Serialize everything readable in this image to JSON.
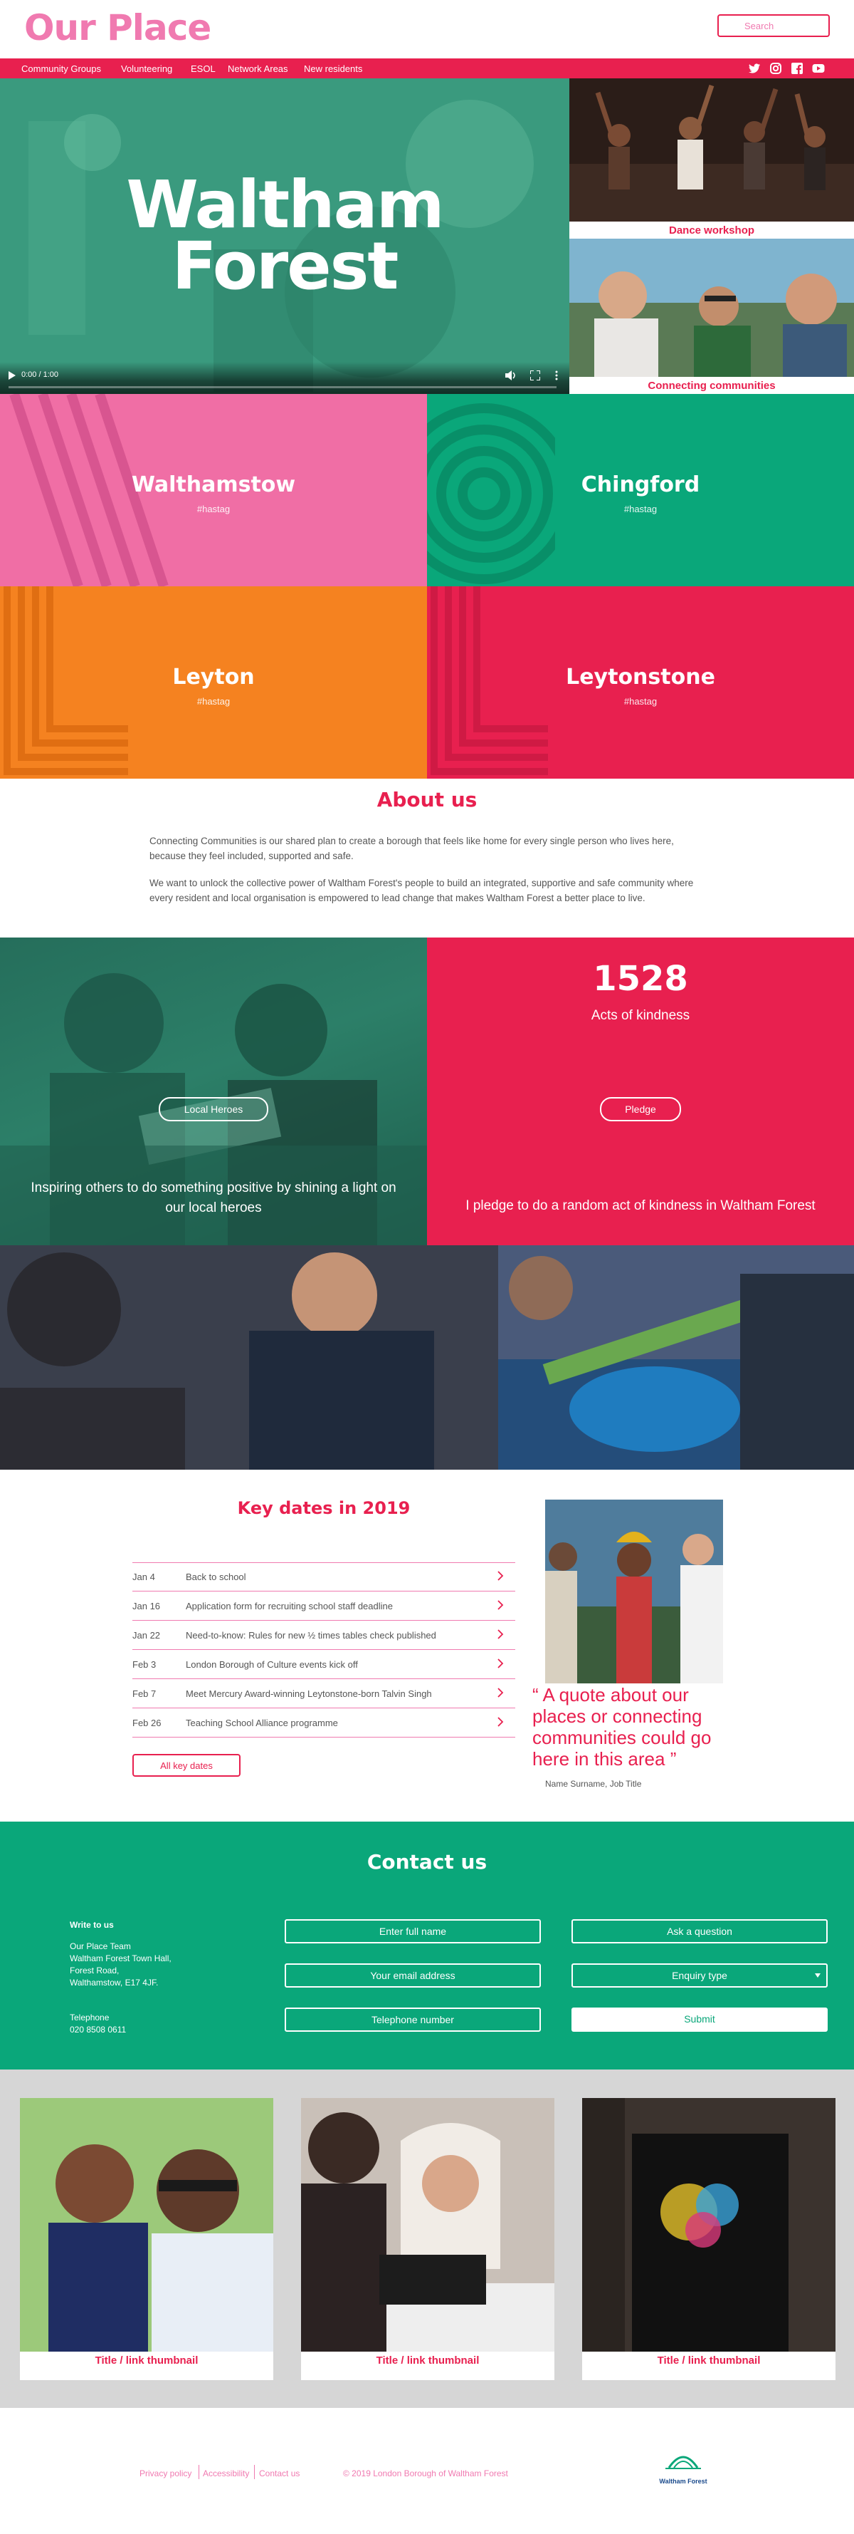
{
  "header": {
    "logo": "Our Place",
    "search_placeholder": "Search"
  },
  "nav": {
    "items": [
      "Community Groups",
      "Volunteering",
      "ESOL",
      "Network Areas",
      "New residents"
    ],
    "social": [
      "twitter-icon",
      "instagram-icon",
      "facebook-icon",
      "youtube-icon"
    ]
  },
  "hero": {
    "title_line1": "Waltham",
    "title_line2": "Forest",
    "video_time": "0:00 / 1:00",
    "video_progress": 0
  },
  "side_cards": [
    {
      "caption": "Dance workshop"
    },
    {
      "caption": "Connecting communities"
    }
  ],
  "areas": [
    {
      "name": "Walthamstow",
      "tag": "#hastag",
      "color": "#f06ea5"
    },
    {
      "name": "Chingford",
      "tag": "#hastag",
      "color": "#0aa77a"
    },
    {
      "name": "Leyton",
      "tag": "#hastag",
      "color": "#f58220"
    },
    {
      "name": "Leytonstone",
      "tag": "#hastag",
      "color": "#e8204f"
    }
  ],
  "about": {
    "title": "About us",
    "p1": "Connecting Communities is our shared plan to create a borough that feels like home for every single person who lives here, because they feel included, supported and safe.",
    "p2": "We want to unlock the collective power of Waltham Forest's people to build an integrated, supportive and safe community where every resident and local organisation is empowered to lead change that makes Waltham Forest a better place to live."
  },
  "heroes": {
    "button": "Local Heroes",
    "caption": "Inspiring others to do something positive by shining a light on our local heroes"
  },
  "pledge": {
    "count": "1528",
    "count_label": "Acts of kindness",
    "button": "Pledge",
    "caption": "I pledge to do a random act of kindness in Waltham Forest"
  },
  "key_dates": {
    "title": "Key dates in 2019",
    "rows": [
      {
        "date": "Jan 4",
        "text": "Back to school"
      },
      {
        "date": "Jan 16",
        "text": "Application form for recruiting school staff deadline"
      },
      {
        "date": "Jan 22",
        "text": "Need-to-know: Rules for new ½ times tables check published"
      },
      {
        "date": "Feb 3",
        "text": "London Borough of Culture events kick off"
      },
      {
        "date": "Feb 7",
        "text": "Meet Mercury Award-winning Leytonstone-born Talvin Singh"
      },
      {
        "date": "Feb 26",
        "text": "Teaching School Alliance programme"
      }
    ],
    "all_button": "All key dates",
    "quote": "A quote about our places or connecting communities could go here in this area",
    "quote_open": "“",
    "quote_close": "”",
    "quote_author": "Name Surname, Job Title"
  },
  "contact": {
    "title": "Contact us",
    "write_heading": "Write to us",
    "address": [
      "Our Place Team",
      "Waltham Forest Town Hall,",
      "Forest Road,",
      "Walthamstow, E17 4JF."
    ],
    "phone_heading": "Telephone",
    "phone": "020 8508 0611",
    "name_placeholder": "Enter full name",
    "email_placeholder": "Your email address",
    "phone_placeholder": "Telephone number",
    "question_placeholder": "Ask a question",
    "enquiry_label": "Enquiry type",
    "submit": "Submit"
  },
  "thumbnails": [
    {
      "caption": "Title / link thumbnail"
    },
    {
      "caption": "Title / link thumbnail"
    },
    {
      "caption": "Title / link thumbnail"
    }
  ],
  "footer": {
    "links": [
      "Privacy policy",
      "Accessibility",
      "Contact us"
    ],
    "copyright": "© 2019 London Borough of Waltham Forest",
    "logo_text": "Waltham Forest"
  },
  "colors": {
    "pink": "#f06ea5",
    "red": "#e8204f",
    "green": "#0aa77a",
    "orange": "#f58220"
  }
}
